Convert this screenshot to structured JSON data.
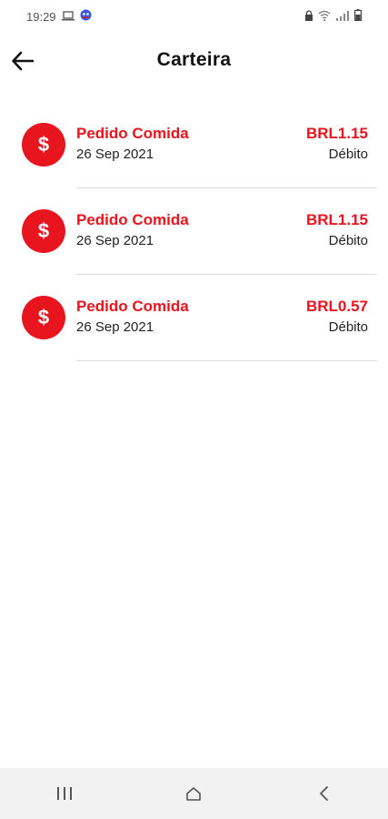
{
  "status_bar": {
    "time": "19:29",
    "icons": [
      "laptop-icon",
      "face-icon",
      "lock-icon",
      "wifi-icon",
      "signal-icon",
      "battery-icon"
    ]
  },
  "header": {
    "title": "Carteira",
    "back_icon": "arrow-left-icon"
  },
  "colors": {
    "accent": "#e8141e",
    "text": "#222222",
    "divider": "#dddddd",
    "nav_bg": "#f2f2f2"
  },
  "transactions": [
    {
      "icon": "$",
      "title": "Pedido Comida",
      "date": "26 Sep 2021",
      "amount": "BRL1.15",
      "type": "Débito"
    },
    {
      "icon": "$",
      "title": "Pedido Comida",
      "date": "26 Sep 2021",
      "amount": "BRL1.15",
      "type": "Débito"
    },
    {
      "icon": "$",
      "title": "Pedido Comida",
      "date": "26 Sep 2021",
      "amount": "BRL0.57",
      "type": "Débito"
    }
  ],
  "nav": {
    "items": [
      "recent-apps-icon",
      "home-icon",
      "back-icon"
    ]
  }
}
